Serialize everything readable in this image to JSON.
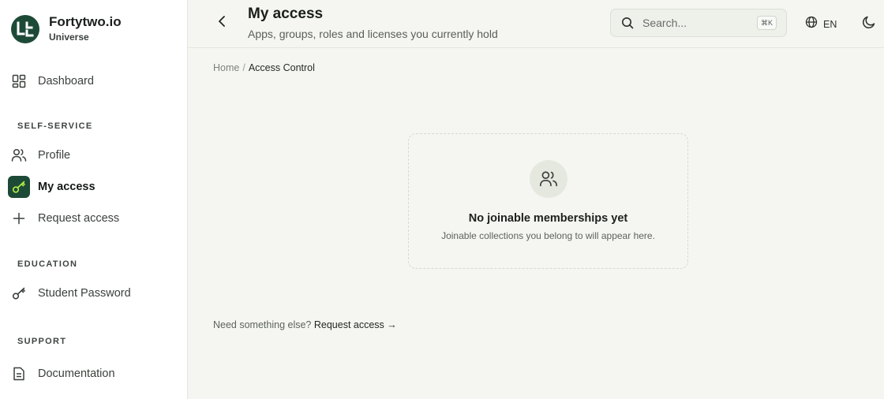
{
  "brand": {
    "name": "Fortytwo.io",
    "sub": "Universe"
  },
  "sidebar": {
    "dashboard": "Dashboard",
    "sections": {
      "self_service": "SELF-SERVICE",
      "education": "EDUCATION",
      "support": "SUPPORT"
    },
    "items": {
      "profile": "Profile",
      "my_access": "My access",
      "request_access": "Request access",
      "student_password": "Student Password",
      "documentation": "Documentation"
    },
    "active_item": "My access"
  },
  "header": {
    "title": "My access",
    "subtitle": "Apps, groups, roles and licenses you currently hold",
    "search_placeholder": "Search...",
    "search_shortcut": "⌘K",
    "language": "EN"
  },
  "breadcrumb": {
    "home": "Home",
    "separator": "/",
    "current": "Access Control"
  },
  "empty_state": {
    "title": "No joinable memberships yet",
    "description": "Joinable collections you belong to will appear here."
  },
  "footer": {
    "prompt": "Need something else?",
    "link": "Request access →"
  },
  "colors": {
    "accent": "#1d4a37",
    "accent_icon": "#b6f046",
    "background": "#f5f6f1"
  },
  "icons": {
    "dashboard": "grid-icon",
    "profile": "users-icon",
    "my_access": "key-icon",
    "request_access": "plus-icon",
    "student_password": "key-icon",
    "documentation": "document-icon",
    "back": "chevron-left-icon",
    "search": "search-icon",
    "language": "globe-icon",
    "theme": "moon-icon",
    "empty": "users-icon"
  }
}
